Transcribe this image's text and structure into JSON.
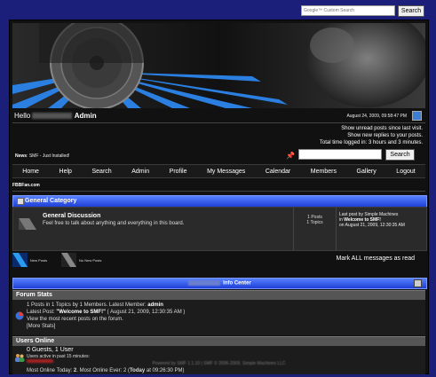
{
  "top_search": {
    "placeholder": "Google™ Custom Search",
    "button": "Search"
  },
  "header": {
    "hello_prefix": "Hello",
    "username": "Admin",
    "date": "August 24, 2009, 09:58:47 PM",
    "unread": "Show unread posts since last visit.",
    "new_replies": "Show new replies to your posts.",
    "time_logged": "Total time logged in: 3 hours and 3 minutes."
  },
  "news": {
    "label": "News",
    "text": ": SMF - Just Installed!"
  },
  "search": {
    "button": "Search"
  },
  "menu": [
    "Home",
    "Help",
    "Search",
    "Admin",
    "Profile",
    "My Messages",
    "Calendar",
    "Members",
    "Gallery",
    "Logout"
  ],
  "breadcrumb": "FBBFan.com",
  "category": {
    "title": "General Category"
  },
  "board": {
    "name": "General Discussion",
    "description": "Feel free to talk about anything and everything in this board.",
    "posts": "1 Posts",
    "topics": "1 Topics",
    "last_post_line1": "Last post by Simple Machines",
    "last_post_in": "in",
    "last_post_topic": "Welcome to SMF!",
    "last_post_date": "on August 21, 2009, 12:30:35 AM"
  },
  "legend": {
    "new": "New Posts",
    "no_new": "No New Posts",
    "mark_all": "Mark ALL messages as read"
  },
  "info_center": {
    "title": "Info Center"
  },
  "forum_stats": {
    "title": "Forum Stats",
    "line1_prefix": "1 Posts in 1 Topics by 1 Members. Latest Member:",
    "latest_member": "admin",
    "line2_prefix": "Latest Post:",
    "latest_post": "\"Welcome to SMF!\"",
    "line2_suffix": "( August 21, 2009, 12:30:35 AM )",
    "line3": "View the most recent posts on the forum.",
    "line4": "[More Stats]"
  },
  "users_online": {
    "title": "Users Online",
    "count": "0 Guests, 1 User",
    "active": "Users active in past 15 minutes:",
    "most_prefix": "Most Online Today:",
    "most_today": "2",
    "most_ever_prefix": ". Most Online Ever: 2 (",
    "most_ever_date": "Today",
    "most_ever_suffix": "at 09:26:30 PM)"
  },
  "footer": "Powered by SMF 1.1.10 | SMF © 2006-2009, Simple Machines LLC",
  "colors": {
    "page_bg": "#1b1f7a",
    "accent_blue": "#1f3fd6",
    "panel": "#111111"
  }
}
